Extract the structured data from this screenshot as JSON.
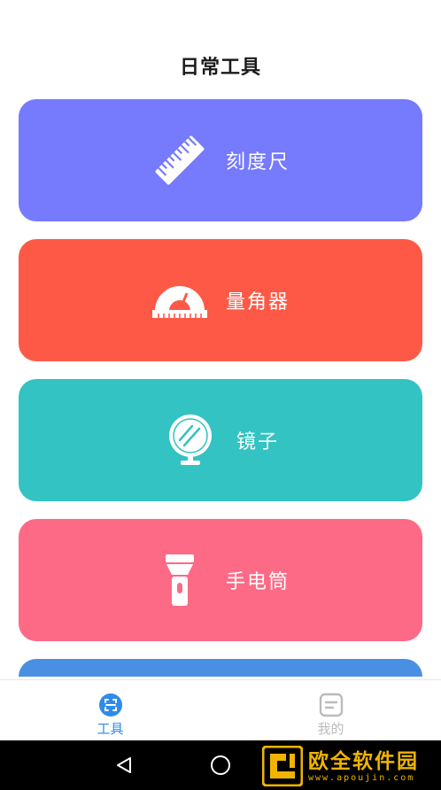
{
  "header": {
    "title": "日常工具"
  },
  "tools": [
    {
      "label": "刻度尺",
      "color": "#767AFD",
      "icon": "ruler-icon"
    },
    {
      "label": "量角器",
      "color": "#FE5947",
      "icon": "protractor-icon"
    },
    {
      "label": "镜子",
      "color": "#32C3C2",
      "icon": "mirror-icon"
    },
    {
      "label": "手电筒",
      "color": "#FC6A86",
      "icon": "flashlight-icon"
    }
  ],
  "next_card_color": "#4A90E2",
  "tabbar": {
    "tabs": [
      {
        "label": "工具",
        "active": true,
        "icon": "tools-scan-icon",
        "color": "#2F8BE9"
      },
      {
        "label": "我的",
        "active": false,
        "icon": "profile-doc-icon",
        "color": "#BBBBBB"
      }
    ]
  },
  "navbar": {
    "back_icon": "triangle-back-icon",
    "home_icon": "circle-home-icon"
  },
  "watermark": {
    "text": "欧全软件园",
    "url": "www.apoujin.com",
    "color": "#F0B400"
  }
}
